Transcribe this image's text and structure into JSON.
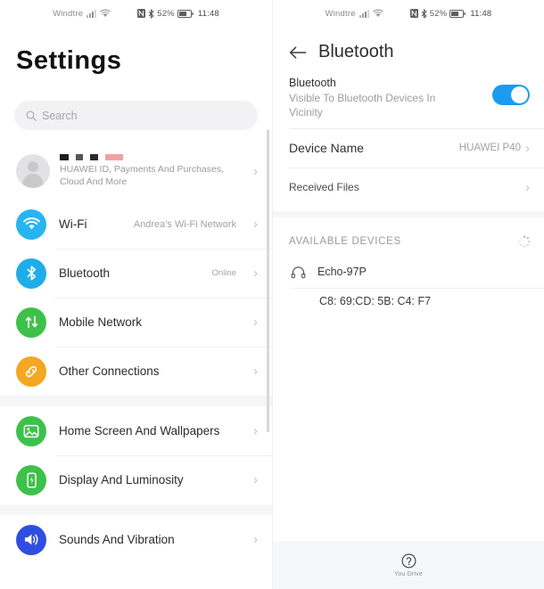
{
  "status_bar": {
    "carrier": "Windtre",
    "battery_percent": "52%",
    "time": "11:48"
  },
  "left_panel": {
    "title": "Settings",
    "search": {
      "placeholder": "Search"
    },
    "account": {
      "subtitle": "HUAWEI ID, Payments And Purchases, Cloud And More",
      "chevron": "›"
    },
    "groups": [
      {
        "items": [
          {
            "label": "Wi-Fi",
            "value": "Andrea's Wi-Fi Network",
            "icon": "wifi-icon",
            "color": "#27b5f0"
          },
          {
            "label": "Bluetooth",
            "value": "Online",
            "icon": "bluetooth-icon",
            "color": "#1fade9"
          },
          {
            "label": "Mobile Network",
            "value": "",
            "icon": "mobile-network-icon",
            "color": "#3ec14b"
          },
          {
            "label": "Other Connections",
            "value": "",
            "icon": "link-icon",
            "color": "#f5a623"
          }
        ]
      },
      {
        "items": [
          {
            "label": "Home Screen And Wallpapers",
            "value": "",
            "icon": "image-icon",
            "color": "#3ec14b"
          },
          {
            "label": "Display And Luminosity",
            "value": "",
            "icon": "display-icon",
            "color": "#3ec14b"
          }
        ]
      },
      {
        "items": [
          {
            "label": "Sounds And Vibration",
            "value": "",
            "icon": "speaker-icon",
            "color": "#2f4ee0"
          }
        ]
      }
    ],
    "chevron": "›"
  },
  "right_panel": {
    "title": "Bluetooth",
    "back_icon": "arrow-left-icon",
    "toggle": {
      "label": "Bluetooth",
      "subtitle": "Visible To Bluetooth Devices In Vicinity",
      "state": "on",
      "accent": "#1a9cf0"
    },
    "rows": [
      {
        "label": "Device Name",
        "value": "HUAWEI P40",
        "chevron": "›"
      },
      {
        "label": "Received Files",
        "value": "",
        "chevron": "›"
      }
    ],
    "available_devices": {
      "header": "AVAILABLE DEVICES",
      "spinner": "loading-spinner",
      "devices": [
        {
          "name": "Echo-97P",
          "icon": "headphones-icon"
        },
        {
          "name": "C8: 69:CD: 5B: C4: F7",
          "icon": ""
        }
      ]
    },
    "bottom_bar": {
      "icon": "help-icon",
      "label": "You Drive"
    }
  }
}
